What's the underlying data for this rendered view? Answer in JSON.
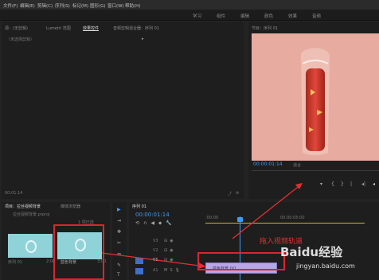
{
  "menu": [
    "文件(F)",
    "编辑(E)",
    "剪辑(C)",
    "序列(S)",
    "标记(M)",
    "图形(G)",
    "窗口(W)",
    "帮助(H)"
  ],
  "workspaces": [
    "学习",
    "组件",
    "编辑",
    "颜色",
    "效果",
    "音频"
  ],
  "source_tabs": [
    "源：(无剪辑)",
    "Lumetri 范围",
    "效果控件",
    "音频剪辑混合器：序列 01"
  ],
  "effect_controls": {
    "no_clip": "（未选择剪辑）",
    "timecode": "00:01:14"
  },
  "program": {
    "title": "节目：序列 01",
    "timecode": "00:00:01:14",
    "fit": "适合"
  },
  "project": {
    "tabs": [
      "项目：拉丝视频背景",
      "媒体浏览器"
    ],
    "file": "拉丝视频背景.prproj",
    "filter_label": "1 项已选"
  },
  "clips": [
    {
      "name": "序列 01",
      "duration": "2:00"
    },
    {
      "name": "蓝色背景",
      "duration": "3:00"
    }
  ],
  "sequence": {
    "tab": "序列 01",
    "timecode": "00:00:01:14",
    "ruler_start": ":00:00",
    "ruler_mid": "00:00:05:00"
  },
  "tracks": [
    {
      "label": "V3"
    },
    {
      "label": "V2"
    },
    {
      "label": "V1",
      "clip": "蓝色背景.[V]"
    },
    {
      "label": "A1"
    }
  ],
  "annotation": "拖入视频轨道",
  "watermark": {
    "brand": "Baidu经验",
    "url": "jingyan.baidu.com"
  },
  "colors": {
    "accent": "#3f9cf5",
    "highlight_box": "#d9262c",
    "clip_purple": "#b7a7e6",
    "thumb": "#8fd3d9",
    "preview_bg": "#e8aba0"
  }
}
